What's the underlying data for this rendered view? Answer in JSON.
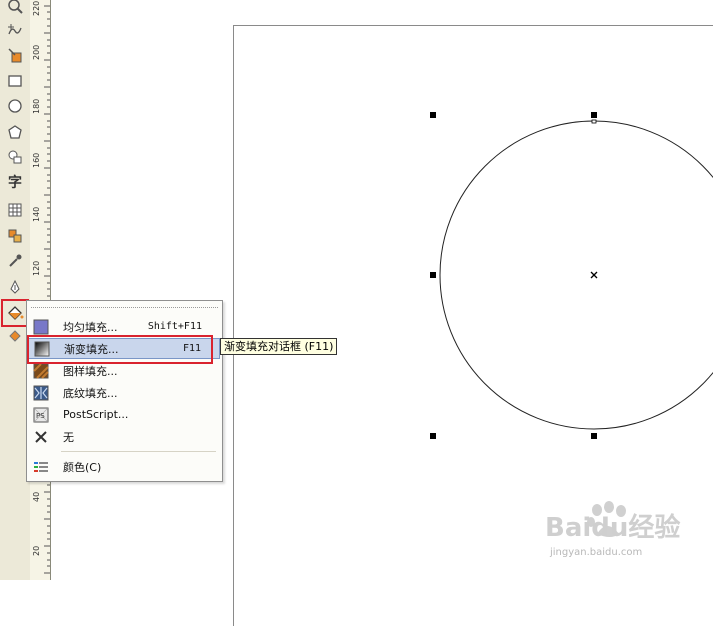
{
  "ruler": {
    "labels": [
      "220",
      "200",
      "180",
      "160",
      "140",
      "120",
      "40",
      "20"
    ]
  },
  "toolbox": {
    "text_tool": "字"
  },
  "fill_menu": {
    "items": [
      {
        "label": "均匀填充...",
        "shortcut": "Shift+F11",
        "icon": "uniform-fill-icon"
      },
      {
        "label": "渐变填充...",
        "shortcut": "F11",
        "icon": "fountain-fill-icon"
      },
      {
        "label": "图样填充...",
        "icon": "pattern-fill-icon"
      },
      {
        "label": "底纹填充...",
        "icon": "texture-fill-icon"
      },
      {
        "label": "PostScript...",
        "icon": "postscript-fill-icon"
      },
      {
        "label": "无",
        "icon": "no-fill-icon"
      },
      {
        "label": "颜色(C)",
        "icon": "color-docker-icon"
      }
    ],
    "tooltip": "渐变填充对话框 (F11)"
  },
  "watermark": {
    "brand": "Baidu经验",
    "url": "jingyan.baidu.com"
  },
  "colors": {
    "highlight_red": "#d9232e",
    "menu_selected": "#c9d6ec"
  }
}
